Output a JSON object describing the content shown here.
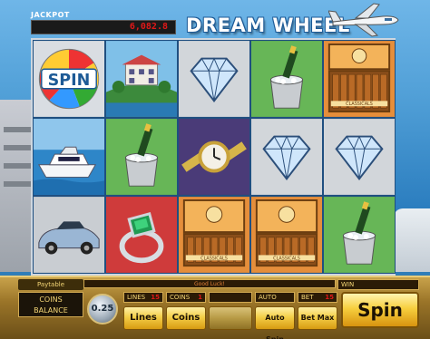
{
  "header": {
    "jackpot_label": "JACKPOT",
    "jackpot_value": "6,082.8",
    "title": "DREAM WHEEL"
  },
  "reels": [
    [
      "spin-wheel",
      "yacht",
      "sports-car"
    ],
    [
      "mansion",
      "champagne",
      "emerald-ring"
    ],
    [
      "diamond",
      "watch",
      "cigar-box"
    ],
    [
      "champagne",
      "diamond",
      "cigar-box"
    ],
    [
      "cigar-box",
      "diamond",
      "champagne"
    ]
  ],
  "symbol_labels": {
    "spin": "SPIN",
    "cigar_brand": "CLASSICALS"
  },
  "controls": {
    "paytable": "Paytable",
    "coins_balance_label": "COINS\nBALANCE",
    "coin_value": "0.25",
    "status": "Good Luck!",
    "lines_label": "LINES",
    "lines_value": "15",
    "coins_label": "COINS",
    "coins_value": "1",
    "auto_label": "AUTO",
    "bet_label": "BET",
    "bet_value": "15",
    "win_label": "WIN",
    "lines_button": "Lines",
    "coins_button": "Coins",
    "autospin_button": "Auto Spin",
    "betmax_button": "Bet Max",
    "spin_button": "Spin"
  }
}
